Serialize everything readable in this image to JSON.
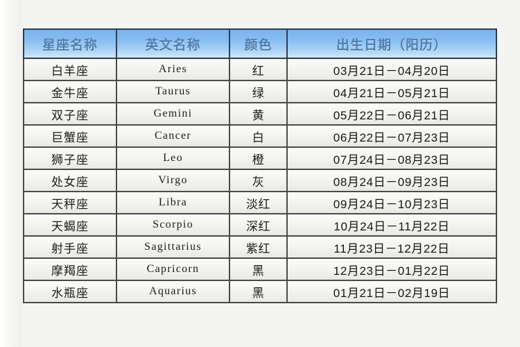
{
  "page": {
    "top_caption": "· · ·   · ·   · · ·",
    "background_color": "#f2f2f0"
  },
  "table": {
    "name": "zodiac-sign-reference-table",
    "accent_header_color": "#79b4ec",
    "header_text_color": "#4d7fae",
    "border_color": "#4a4a4a",
    "columns": [
      {
        "key": "name",
        "label": "星座名称"
      },
      {
        "key": "en",
        "label": "英文名称"
      },
      {
        "key": "color",
        "label": "颜色"
      },
      {
        "key": "date",
        "label": "出生日期（阳历）"
      }
    ],
    "rows": [
      {
        "name": "白羊座",
        "en": "Aries",
        "color": "红",
        "date": "03月21日－04月20日"
      },
      {
        "name": "金牛座",
        "en": "Taurus",
        "color": "绿",
        "date": "04月21日－05月21日"
      },
      {
        "name": "双子座",
        "en": "Gemini",
        "color": "黄",
        "date": "05月22日－06月21日"
      },
      {
        "name": "巨蟹座",
        "en": "Cancer",
        "color": "白",
        "date": "06月22日－07月23日"
      },
      {
        "name": "狮子座",
        "en": "Leo",
        "color": "橙",
        "date": "07月24日－08月23日"
      },
      {
        "name": "处女座",
        "en": "Virgo",
        "color": "灰",
        "date": "08月24日－09月23日"
      },
      {
        "name": "天秤座",
        "en": "Libra",
        "color": "淡红",
        "date": "09月24日－10月23日"
      },
      {
        "name": "天蝎座",
        "en": "Scorpio",
        "color": "深红",
        "date": "10月24日－11月22日"
      },
      {
        "name": "射手座",
        "en": "Sagittarius",
        "color": "紫红",
        "date": "11月23日－12月22日"
      },
      {
        "name": "摩羯座",
        "en": "Capricorn",
        "color": "黑",
        "date": "12月23日－01月22日"
      },
      {
        "name": "水瓶座",
        "en": "Aquarius",
        "color": "黑",
        "date": "01月21日－02月19日"
      }
    ]
  }
}
